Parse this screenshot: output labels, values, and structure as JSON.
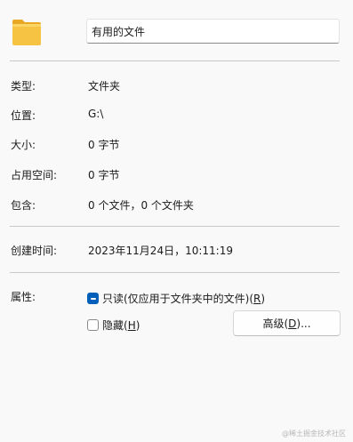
{
  "header": {
    "icon": "folder-icon",
    "name_value": "有用的文件"
  },
  "properties": {
    "type_label": "类型:",
    "type_value": "文件夹",
    "location_label": "位置:",
    "location_value": "G:\\",
    "size_label": "大小:",
    "size_value": "0 字节",
    "size_on_disk_label": "占用空间:",
    "size_on_disk_value": "0 字节",
    "contains_label": "包含:",
    "contains_value": "0 个文件，0 个文件夹"
  },
  "created": {
    "label": "创建时间:",
    "value": "2023年11月24日，10:11:19"
  },
  "attributes": {
    "label": "属性:",
    "readonly_text": "只读(仅应用于文件夹中的文件)(",
    "readonly_key": "R",
    "readonly_close": ")",
    "readonly_checked": true,
    "hidden_text": "隐藏(",
    "hidden_key": "H",
    "hidden_close": ")",
    "hidden_checked": false,
    "advanced_text": "高级(",
    "advanced_key": "D",
    "advanced_close": ")..."
  },
  "watermark": "@稀土掘金技术社区",
  "colors": {
    "accent": "#005fb8",
    "folder": "#f6c343",
    "background": "#f9f9f9"
  }
}
